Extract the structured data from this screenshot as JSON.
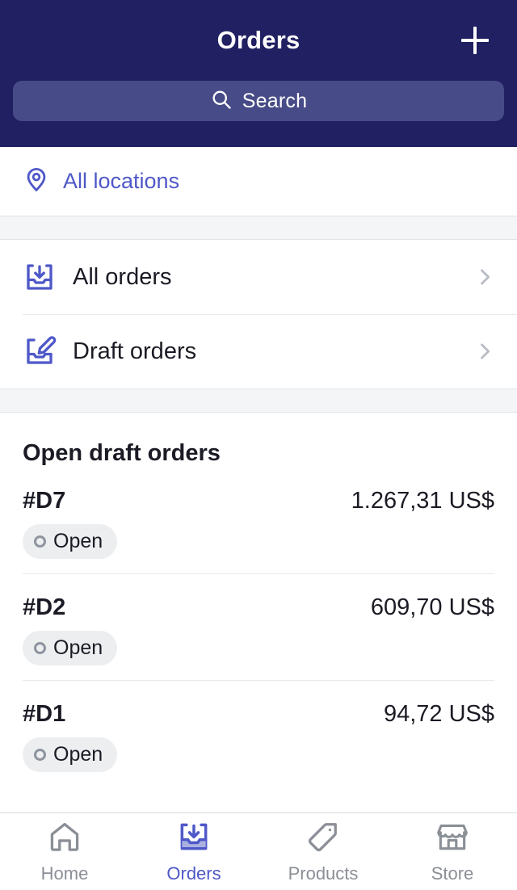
{
  "header": {
    "title": "Orders",
    "add_button_label": "+",
    "add_icon": "plus-icon"
  },
  "search": {
    "placeholder": "Search",
    "value": "",
    "icon": "search-icon"
  },
  "location": {
    "label": "All locations",
    "icon": "map-pin-icon"
  },
  "nav": {
    "items": [
      {
        "label": "All orders",
        "icon": "inbox-download-icon",
        "chevron": "chevron-right-icon"
      },
      {
        "label": "Draft orders",
        "icon": "inbox-pencil-icon",
        "chevron": "chevron-right-icon"
      }
    ]
  },
  "drafts": {
    "title": "Open draft orders",
    "orders": [
      {
        "id": "#D7",
        "total": "1.267,31 US$",
        "status": "Open"
      },
      {
        "id": "#D2",
        "total": "609,70 US$",
        "status": "Open"
      },
      {
        "id": "#D1",
        "total": "94,72 US$",
        "status": "Open"
      }
    ]
  },
  "tabbar": {
    "tabs": [
      {
        "label": "Home",
        "icon": "home-icon",
        "active": false
      },
      {
        "label": "Orders",
        "icon": "inbox-download-icon",
        "active": true
      },
      {
        "label": "Products",
        "icon": "tag-icon",
        "active": false
      },
      {
        "label": "Store",
        "icon": "storefront-icon",
        "active": false
      }
    ]
  },
  "colors": {
    "header_bg": "#212062",
    "search_bg": "#474b87",
    "accent": "#4e58c8",
    "text_primary": "#1b1b25",
    "text_muted": "#8b8f96",
    "badge_bg": "#eceef0",
    "spacer_bg": "#f4f5f7"
  }
}
